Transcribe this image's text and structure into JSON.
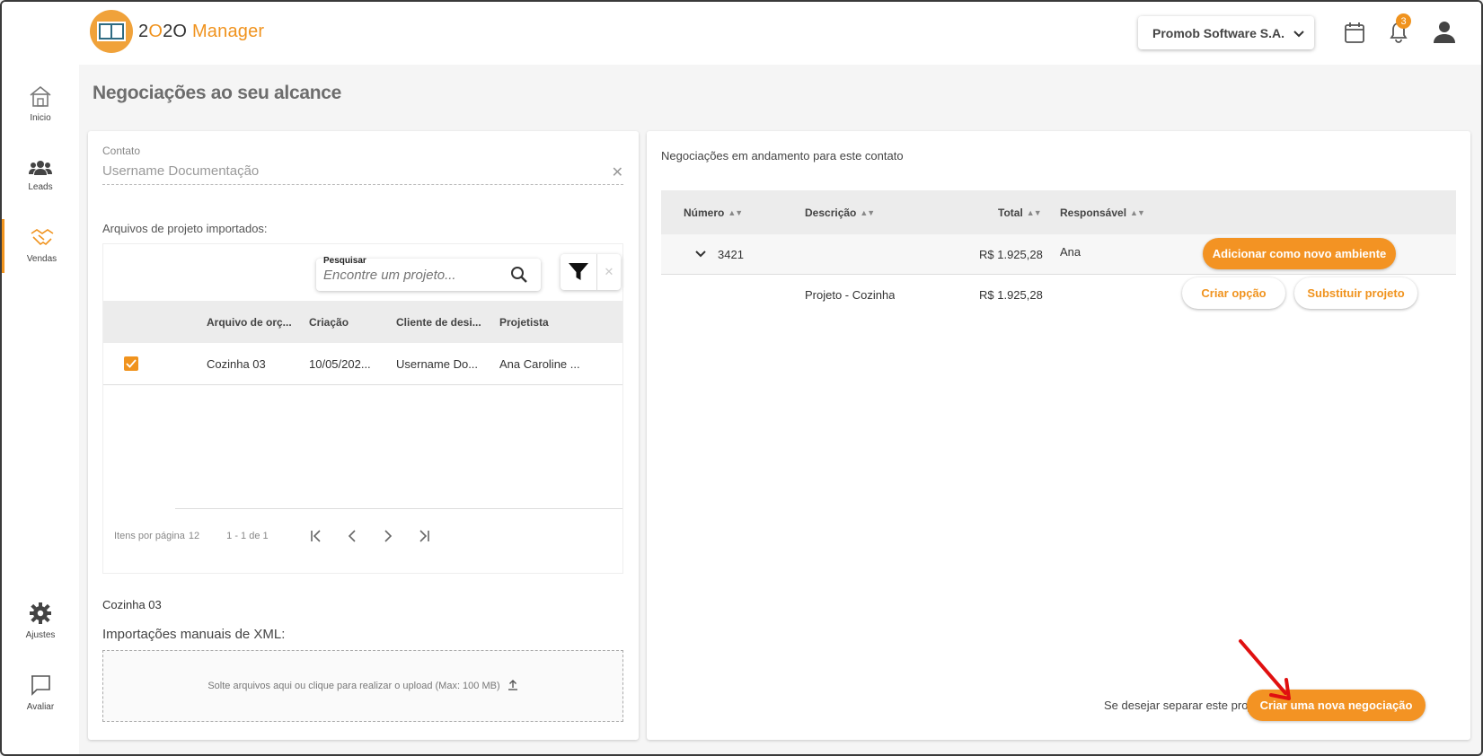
{
  "header": {
    "logo_prefix": "2",
    "logo_o": "O",
    "logo_middle": "2O",
    "logo_suffix": " Manager",
    "company": "Promob Software S.A.",
    "notifications_count": "3"
  },
  "sidebar": {
    "items": [
      {
        "label": "Inicio",
        "icon": "home-icon"
      },
      {
        "label": "Leads",
        "icon": "people-icon"
      },
      {
        "label": "Vendas",
        "icon": "handshake-icon"
      },
      {
        "label": "Ajustes",
        "icon": "gear-icon"
      },
      {
        "label": "Avaliar",
        "icon": "chat-icon"
      }
    ]
  },
  "page_title": "Negociações ao seu alcance",
  "left": {
    "contact_label": "Contato",
    "contact_value": "Username Documentação",
    "imported_label": "Arquivos de projeto importados:",
    "search_label": "Pesquisar",
    "search_placeholder": "Encontre um projeto...",
    "columns": [
      "Arquivo de orç...",
      "Criação",
      "Cliente de desi...",
      "Projetista"
    ],
    "rows": [
      {
        "file": "Cozinha 03",
        "created": "10/05/202...",
        "client": "Username Do...",
        "designer": "Ana Caroline ..."
      }
    ],
    "pager": {
      "items_per_page_label": "Itens por página",
      "items_per_page": "12",
      "range": "1 - 1 de 1"
    },
    "selected_file": "Cozinha 03",
    "xml_label": "Importações manuais de XML:",
    "dropzone_text": "Solte arquivos aqui ou clique para realizar o upload (Max: 100 MB)"
  },
  "right": {
    "title": "Negociações em andamento para este contato",
    "columns": {
      "number": "Número",
      "description": "Descrição",
      "total": "Total",
      "responsible": "Responsável"
    },
    "negotiation": {
      "number": "3421",
      "total": "R$ 1.925,28",
      "responsible": "Ana",
      "add_button": "Adicionar como novo ambiente"
    },
    "project": {
      "description": "Projeto - Cozinha",
      "total": "R$ 1.925,28",
      "create_option_button": "Criar opção",
      "replace_button": "Substituir projeto"
    },
    "separate_text": "Se desejar separar este projeto",
    "new_negotiation_button": "Criar uma nova negociação"
  },
  "colors": {
    "accent": "#f39323",
    "arrow": "#e01010"
  }
}
